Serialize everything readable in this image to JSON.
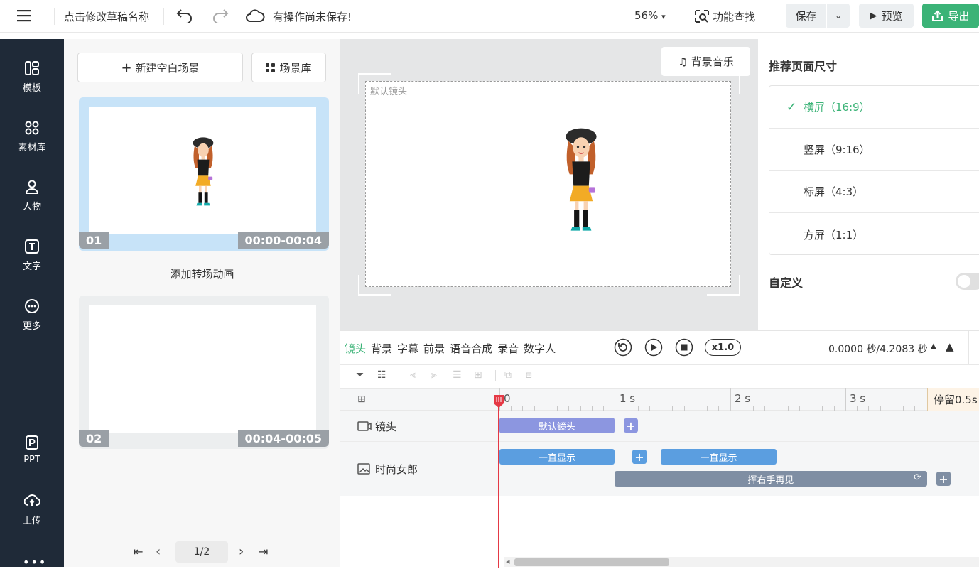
{
  "header": {
    "menu_icon": "hamburger-menu-icon",
    "draft_name": "点击修改草稿名称",
    "unsaved_status": "有操作尚未保存!",
    "zoom": "56%",
    "feature_search": "功能查找",
    "save": "保存",
    "preview": "预览",
    "export": "导出",
    "accent_color": "#3bb377"
  },
  "sidebar": {
    "items": [
      {
        "label": "模板",
        "icon": "template-icon"
      },
      {
        "label": "素材库",
        "icon": "material-library-icon"
      },
      {
        "label": "人物",
        "icon": "person-icon"
      },
      {
        "label": "文字",
        "icon": "text-icon"
      },
      {
        "label": "更多",
        "icon": "more-icon"
      },
      {
        "label": "PPT",
        "icon": "ppt-icon"
      },
      {
        "label": "上传",
        "icon": "upload-icon"
      }
    ]
  },
  "scenes": {
    "new_scene": "新建空白场景",
    "scene_library": "场景库",
    "items": [
      {
        "index": "01",
        "time": "00:00-00:04"
      },
      {
        "index": "02",
        "time": "00:04-00:05"
      }
    ],
    "add_transition": "添加转场动画",
    "pagination": "1/2"
  },
  "canvas": {
    "bg_music": "背景音乐",
    "camera_label": "默认镜头"
  },
  "page_size": {
    "title": "推荐页面尺寸",
    "options": [
      {
        "label": "横屏（16:9）",
        "selected": true
      },
      {
        "label": "竖屏（9:16）",
        "selected": false
      },
      {
        "label": "标屏（4:3）",
        "selected": false
      },
      {
        "label": "方屏（1:1）",
        "selected": false
      }
    ],
    "custom": "自定义"
  },
  "timeline": {
    "tabs": [
      "镜头",
      "背景",
      "字幕",
      "前景",
      "语音合成",
      "录音",
      "数字人"
    ],
    "speed": "x1.0",
    "time_readout": "0.0000 秒/4.2083 秒",
    "ticks": [
      "0",
      "1 s",
      "2 s",
      "3 s"
    ],
    "stay": "停留0.5s",
    "tracks": {
      "camera_label": "镜头",
      "camera_bar": "默认镜头",
      "character_label": "时尚女郎",
      "show_bar_1": "一直显示",
      "show_bar_2": "一直显示",
      "action_bar": "挥右手再见"
    }
  }
}
